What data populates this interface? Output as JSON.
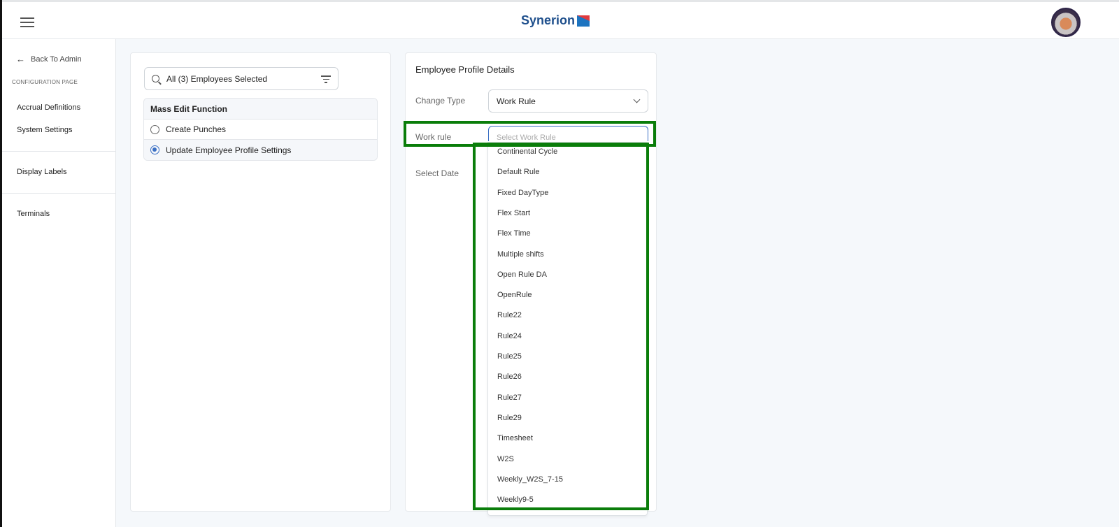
{
  "header": {
    "brand": "Synerion",
    "icons": [
      "hamburger-menu-icon",
      "synerion-logo",
      "user-avatar"
    ]
  },
  "sidebar": {
    "back": "Back To Admin",
    "section": "CONFIGURATION PAGE",
    "items": [
      "Accrual Definitions",
      "System Settings",
      "Display Labels",
      "Terminals"
    ]
  },
  "left_panel": {
    "search_value": "All (3) Employees Selected",
    "mass_edit": {
      "title": "Mass Edit Function",
      "options": [
        {
          "label": "Create Punches",
          "selected": false
        },
        {
          "label": "Update Employee Profile Settings",
          "selected": true
        }
      ]
    }
  },
  "profile": {
    "title": "Employee Profile Details",
    "change_type_label": "Change Type",
    "change_type_value": "Work Rule",
    "work_rule_label": "Work rule",
    "work_rule_placeholder": "Select Work Rule",
    "select_date_label": "Select Date"
  },
  "dropdown": {
    "options": [
      "Continental Cycle",
      "Default Rule",
      "Fixed DayType",
      "Flex Start",
      "Flex Time",
      "Multiple shifts",
      "Open Rule DA",
      "OpenRule",
      "Rule22",
      "Rule24",
      "Rule25",
      "Rule26",
      "Rule27",
      "Rule29",
      "Timesheet",
      "W2S",
      "Weekly_W2S_7-15",
      "Weekly9-5"
    ]
  },
  "colors": {
    "highlight": "#0a7d0a",
    "accent": "#3a6fc4",
    "brand": "#1e4f8c"
  }
}
